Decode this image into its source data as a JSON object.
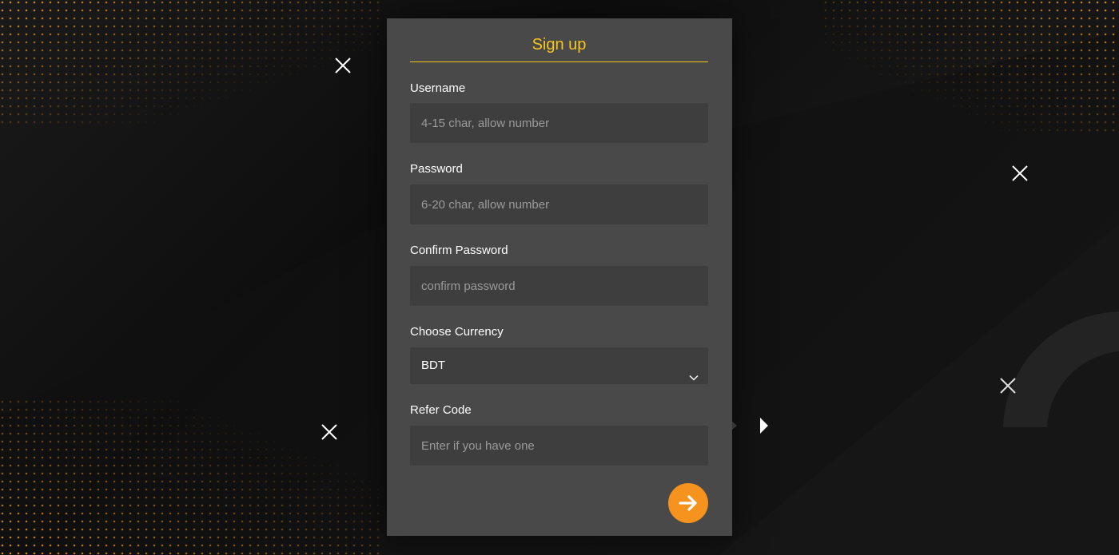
{
  "form": {
    "title": "Sign up",
    "username": {
      "label": "Username",
      "placeholder": "4-15 char, allow number",
      "value": ""
    },
    "password": {
      "label": "Password",
      "placeholder": "6-20 char, allow number",
      "value": ""
    },
    "confirm_password": {
      "label": "Confirm Password",
      "placeholder": "confirm password",
      "value": ""
    },
    "currency": {
      "label": "Choose Currency",
      "selected": "BDT"
    },
    "refer_code": {
      "label": "Refer Code",
      "placeholder": "Enter if you have one",
      "value": ""
    },
    "submit_icon": "arrow-right-icon"
  },
  "theme": {
    "accent": "#f7c51e",
    "button": "#f6921e",
    "panel": "#4a4949",
    "input": "#3f3e3e",
    "background": "#141414",
    "dots": "#d98a1c"
  },
  "decor": {
    "close_icons": [
      "close-icon",
      "close-icon",
      "close-icon",
      "close-icon"
    ],
    "side_arrow_icon": "caret-right-icon"
  }
}
